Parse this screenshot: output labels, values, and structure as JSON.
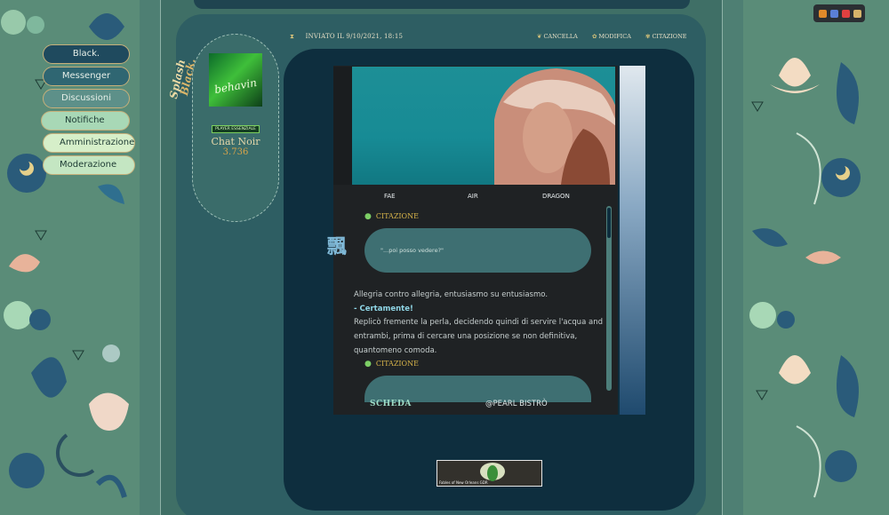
{
  "nav": {
    "items": [
      {
        "label": "Black."
      },
      {
        "label": "Messenger"
      },
      {
        "label": "Discussioni"
      },
      {
        "label": "Notifiche"
      },
      {
        "label": "Amministrazione"
      },
      {
        "label": "Moderazione"
      }
    ]
  },
  "post": {
    "meta": "INVIATO IL 9/10/2021, 18:15",
    "actions": {
      "delete": "CANCELLA",
      "edit": "MODIFICA",
      "quote": "CITAZIONE"
    }
  },
  "author": {
    "logo_line1": "Splash",
    "logo_line2": "Black.",
    "avatar_text": "behavin",
    "rank": "PLAYER ESSENZIALE",
    "name": "Chat Noir",
    "post_count": "3.736"
  },
  "card": {
    "elements": [
      "FAE",
      "AIR",
      "DRAGON"
    ],
    "quote_label_1": "CITAZIONE",
    "quote_text": "\"...poi posso vedere?\"",
    "kanji": "飄",
    "paragraph_1": "Allegria contro allegria, entusiasmo su entusiasmo.",
    "dialog": "- Certamente!",
    "paragraph_2": "Replicò fremente la perla, decidendo quindi di servire l'acqua and entrambi, prima di cercare una posizione se non definitiva, quantomeno comoda.",
    "quote_label_2": "CITAZIONE",
    "footer_left": "SCHEDA",
    "footer_right": "@PEARL BISTRÒ"
  },
  "banner": {
    "text": "Fables of New Orleans GDR"
  },
  "colors": {
    "accent_gold": "#d9b54a",
    "panel_dark": "#0e2e3e",
    "card_bg": "#1f2224",
    "bubble": "#3e6f72"
  }
}
